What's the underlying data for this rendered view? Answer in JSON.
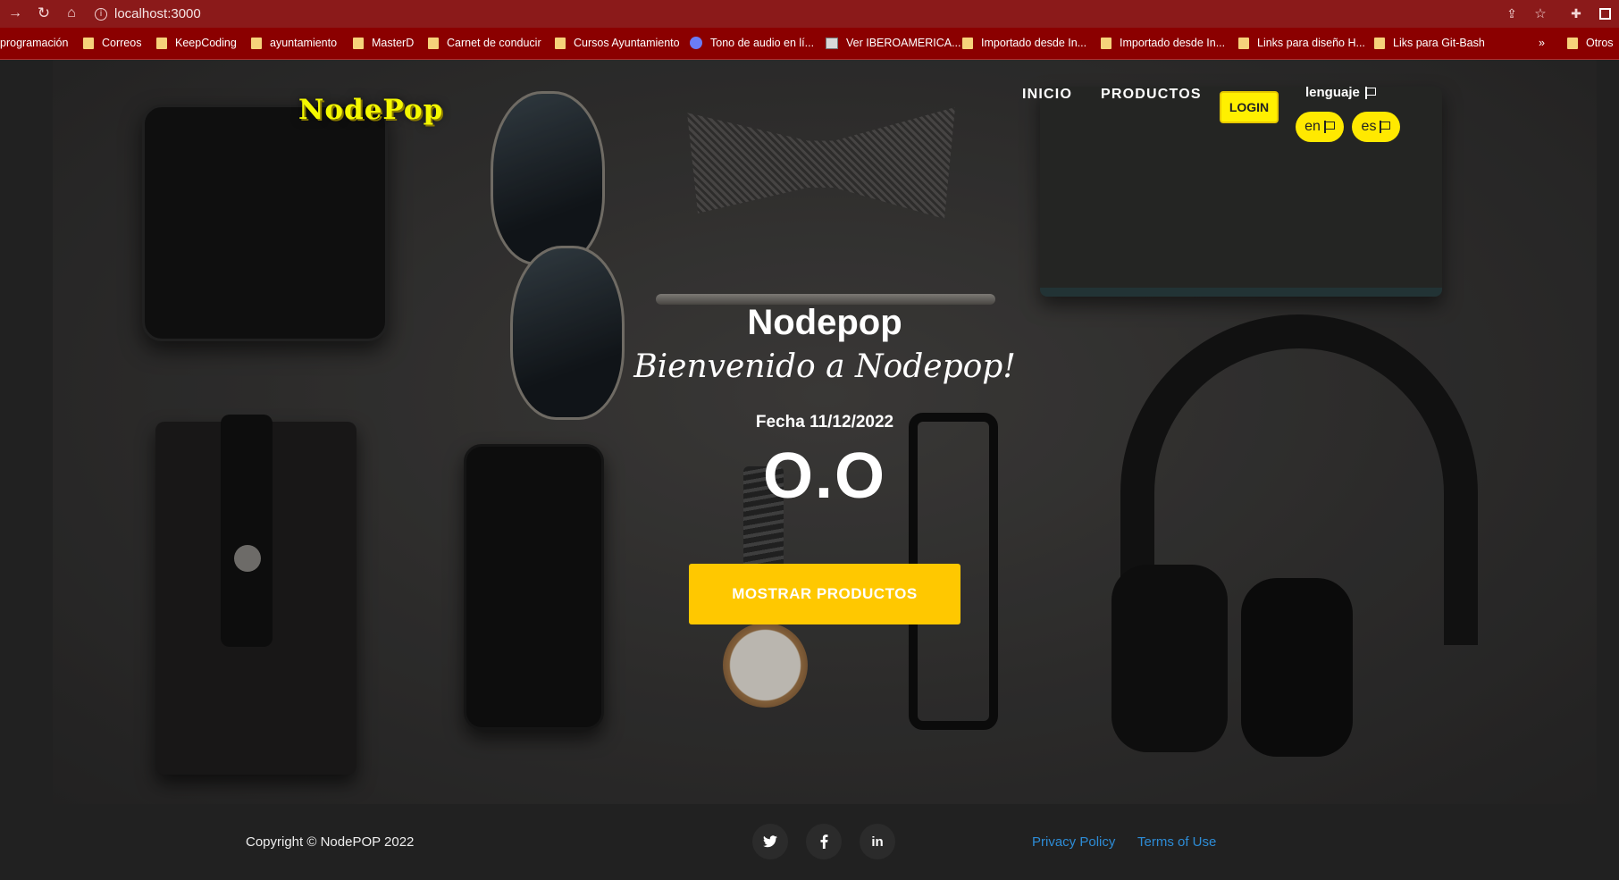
{
  "browser": {
    "url": "localhost:3000",
    "bookmarks": [
      "programación",
      "Correos",
      "KeepCoding",
      "ayuntamiento",
      "MasterD",
      "Carnet de conducir",
      "Cursos Ayuntamiento",
      "Tono de audio en lí...",
      "Ver IBEROAMERICA...",
      "Importado desde In...",
      "Importado desde In...",
      "Links para diseño H...",
      "Liks para Git-Bash",
      "»",
      "Otros"
    ]
  },
  "header": {
    "logo": "NodePop",
    "nav": [
      "INICIO",
      "PRODUCTOS"
    ],
    "login": "LOGIN",
    "language_label": "lenguaje",
    "languages": [
      "en",
      "es"
    ]
  },
  "hero": {
    "title": "Nodepop",
    "subtitle": "Bienvenido a Nodepop!",
    "date": "Fecha 11/12/2022",
    "face": "O.O",
    "cta": "MOSTRAR PRODUCTOS"
  },
  "footer": {
    "copyright": "Copyright © NodePOP 2022",
    "social": [
      "twitter-icon",
      "facebook-icon",
      "linkedin-icon"
    ],
    "links": [
      "Privacy Policy",
      "Terms of Use"
    ]
  },
  "colors": {
    "accent": "#ffc800",
    "brand_yellow": "#fff000",
    "chrome": "#8b1a1a",
    "link": "#2d8cd6"
  }
}
